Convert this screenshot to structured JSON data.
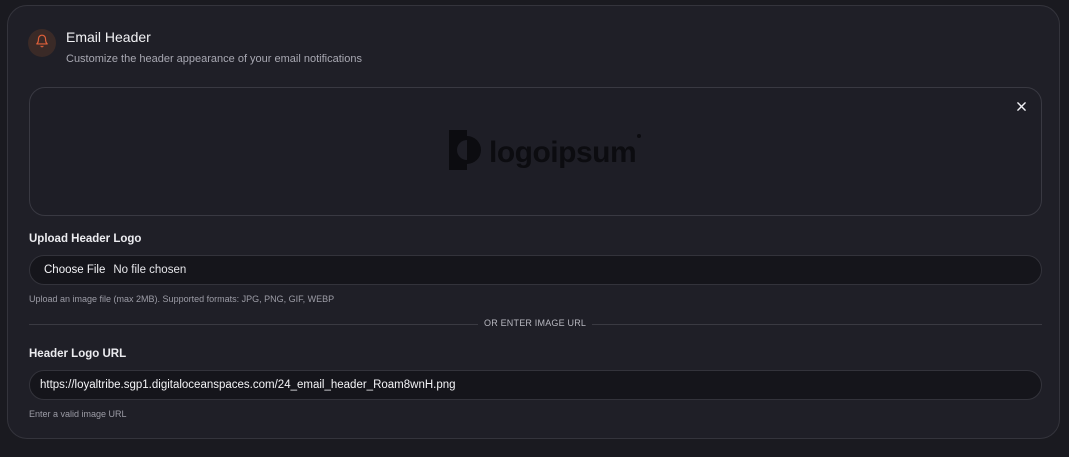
{
  "section": {
    "title": "Email Header",
    "subtitle": "Customize the header appearance of your email notifications",
    "icon": "bell-icon",
    "accent_color": "#e0603a"
  },
  "preview": {
    "logo_text": "logoipsum",
    "close_icon": "close-icon"
  },
  "upload": {
    "label": "Upload Header Logo",
    "button_label": "Choose File",
    "file_status": "No file chosen",
    "help": "Upload an image file (max 2MB). Supported formats: JPG, PNG, GIF, WEBP"
  },
  "divider": {
    "text": "OR ENTER IMAGE URL"
  },
  "url": {
    "label": "Header Logo URL",
    "value": "https://loyaltribe.sgp1.digitaloceanspaces.com/24_email_header_Roam8wnH.png",
    "help": "Enter a valid image URL"
  }
}
